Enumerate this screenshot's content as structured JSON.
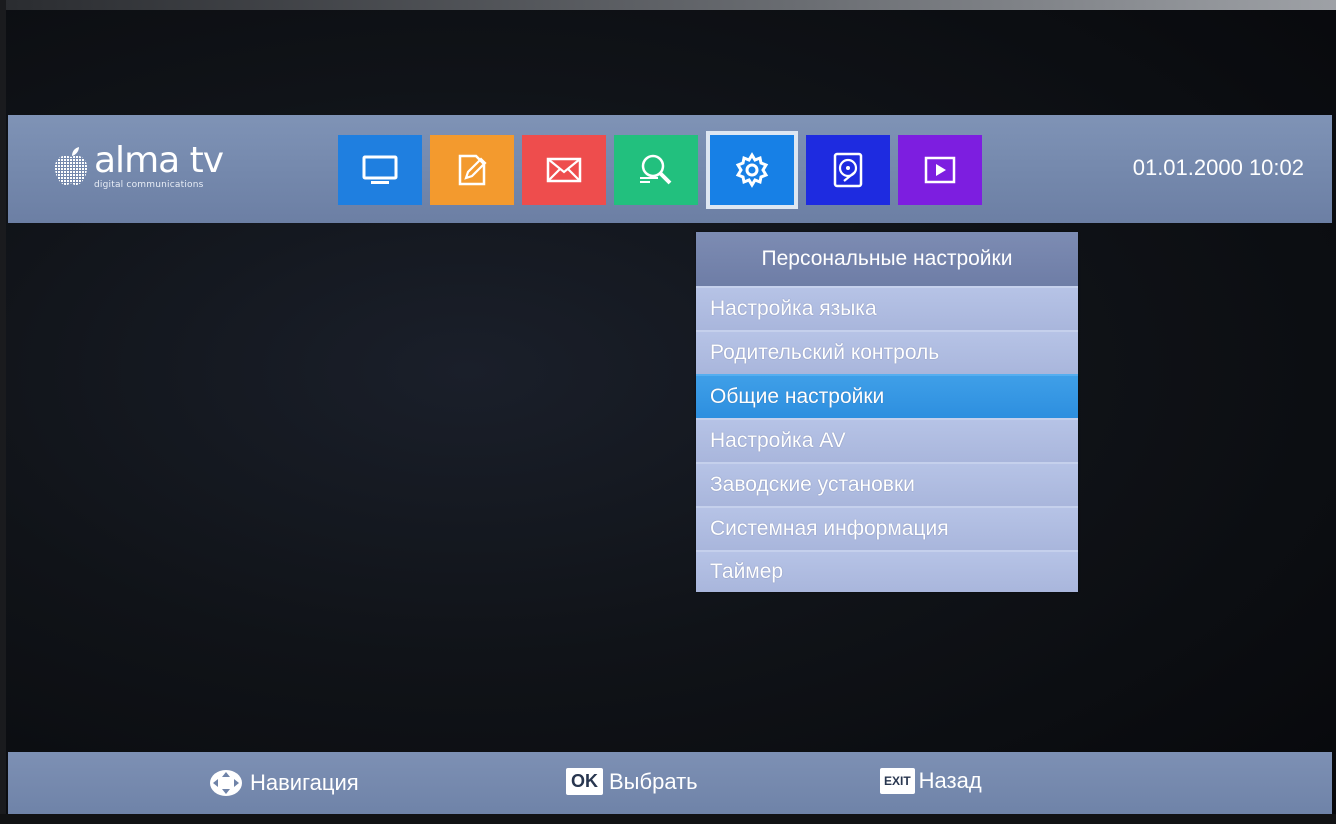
{
  "header": {
    "logo_name": "alma tv",
    "logo_subtitle": "digital communications",
    "datetime": "01.01.2000 10:02",
    "tiles": [
      {
        "name": "tv-icon",
        "color": "#1f7fe0"
      },
      {
        "name": "edit-icon",
        "color": "#f39a2e"
      },
      {
        "name": "mail-icon",
        "color": "#ee4d4d"
      },
      {
        "name": "search-icon",
        "color": "#22c07e"
      },
      {
        "name": "gear-icon",
        "color": "#1780e6",
        "selected": true
      },
      {
        "name": "hard-drive-icon",
        "color": "#1e2be0"
      },
      {
        "name": "play-icon",
        "color": "#7d1ee0"
      }
    ]
  },
  "menu": {
    "title": "Персональные настройки",
    "items": [
      {
        "label": "Настройка языка"
      },
      {
        "label": "Родительский контроль"
      },
      {
        "label": "Общие настройки",
        "active": true
      },
      {
        "label": "Настройка AV"
      },
      {
        "label": "Заводские установки"
      },
      {
        "label": "Системная информация"
      },
      {
        "label": "Таймер"
      }
    ]
  },
  "footer": {
    "navigation_label": "Навигация",
    "ok_badge": "OK",
    "select_label": "Выбрать",
    "exit_badge": "EXIT",
    "back_label": "Назад"
  },
  "colors": {
    "header_bar": "#7589ad",
    "menu_item": "#aebbe0",
    "menu_active": "#2d8fdf"
  }
}
